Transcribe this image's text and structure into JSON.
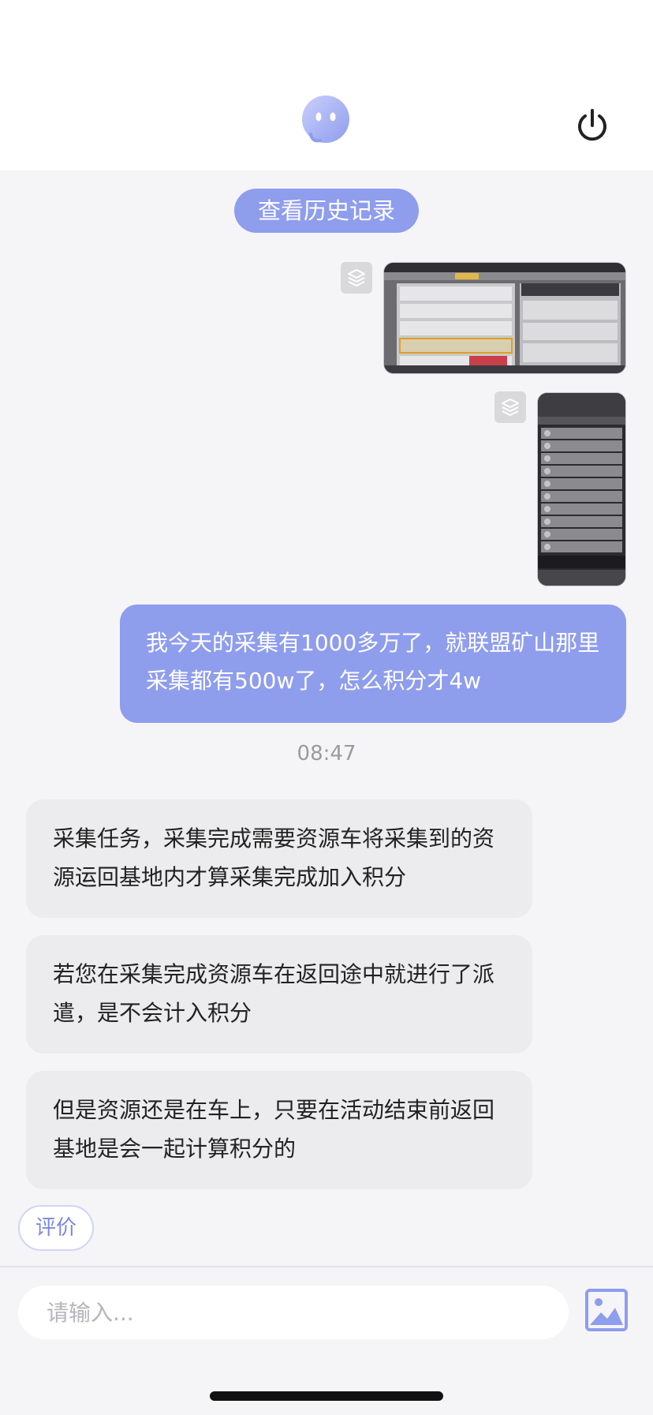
{
  "history_button": {
    "label": "查看历史记录"
  },
  "user_message": {
    "text": "我今天的采集有1000多万了，就联盟矿山那里采集都有500w了，怎么积分才4w"
  },
  "timestamp": "08:47",
  "bot_messages": [
    {
      "text": "采集任务，采集完成需要资源车将采集到的资源运回基地内才算采集完成加入积分"
    },
    {
      "text": "若您在采集完成资源车在返回途中就进行了派遣，是不会计入积分"
    },
    {
      "text": "但是资源还是在车上，只要在活动结束前返回基地是会一起计算积分的"
    }
  ],
  "rate_button": {
    "label": "评价"
  },
  "input": {
    "placeholder": "请输入..."
  },
  "icons": {
    "header_center": "bot-avatar-icon",
    "header_right": "power-icon",
    "thumbnail_badge": "layers-icon",
    "input_right": "image-icon"
  },
  "colors": {
    "accent": "#8f9ded",
    "page_background": "#f5f5f7",
    "bot_bubble": "#ececee",
    "header_background": "#ffffff"
  }
}
